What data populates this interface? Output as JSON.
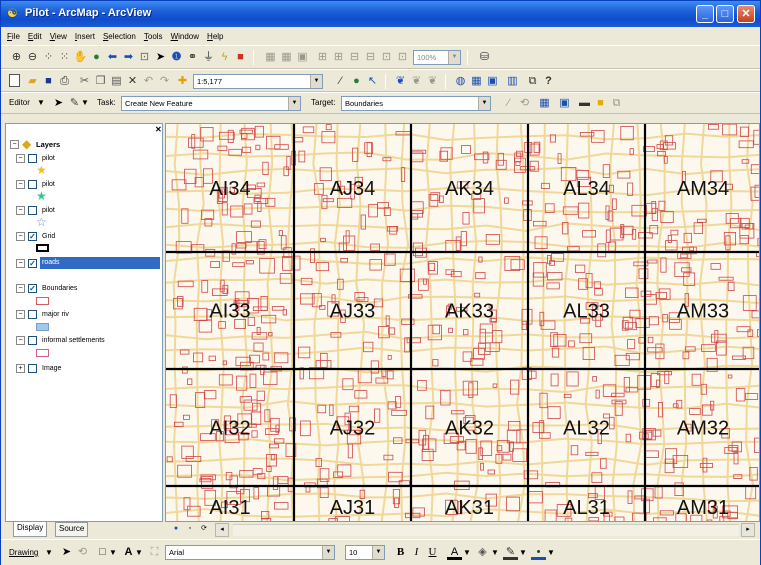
{
  "window": {
    "title": "Pilot - ArcMap - ArcView"
  },
  "menu": [
    "File",
    "Edit",
    "View",
    "Insert",
    "Selection",
    "Tools",
    "Window",
    "Help"
  ],
  "toolbar_standard": {
    "map_scale": "1:5,177",
    "zoom_percent": "100%"
  },
  "toolbar_editor": {
    "editor_label": "Editor",
    "task_label": "Task:",
    "task_value": "Create New Feature",
    "target_label": "Target:",
    "target_value": "Boundaries"
  },
  "toc": {
    "root_label": "Layers",
    "layers": [
      {
        "name": "pilot",
        "checked": false,
        "symbol": "star",
        "symbol_color": "#f0c020"
      },
      {
        "name": "pilot",
        "checked": false,
        "symbol": "star",
        "symbol_color": "#30c890"
      },
      {
        "name": "pilot",
        "checked": false,
        "symbol": "star",
        "symbol_color": "#6a8ac8"
      },
      {
        "name": "Grid",
        "checked": true,
        "symbol": "box",
        "symbol_color": "#000000"
      },
      {
        "name": "roads",
        "checked": true,
        "symbol": "none",
        "symbol_color": "#e0c070",
        "selected": true
      },
      {
        "name": "Boundaries",
        "checked": true,
        "symbol": "box",
        "symbol_color": "#d06060"
      },
      {
        "name": "major riv",
        "checked": false,
        "symbol": "fill",
        "symbol_color": "#a0c8e8"
      },
      {
        "name": "informal settlements",
        "checked": false,
        "symbol": "box",
        "symbol_color": "#d06090"
      },
      {
        "name": "Image",
        "checked": false,
        "symbol": "none",
        "symbol_color": "#000000"
      }
    ],
    "tabs": [
      "Display",
      "Source"
    ]
  },
  "map": {
    "grid_rows": [
      [
        "AI34",
        "AJ34",
        "AK34",
        "AL34",
        "AM34"
      ],
      [
        "AI33",
        "AJ33",
        "AK33",
        "AL33",
        "AM33"
      ],
      [
        "AI32",
        "AJ32",
        "AK32",
        "AL32",
        "AM32"
      ],
      [
        "AI31",
        "AJ31",
        "AK31",
        "AL31",
        "AM31"
      ]
    ],
    "colors": {
      "background": "#fdf8ee",
      "road": "#efd89a",
      "building": "#d0474a",
      "grid": "#000000"
    }
  },
  "toolbar_drawing": {
    "drawing_label": "Drawing",
    "font_name": "Arial",
    "font_size": "10"
  }
}
